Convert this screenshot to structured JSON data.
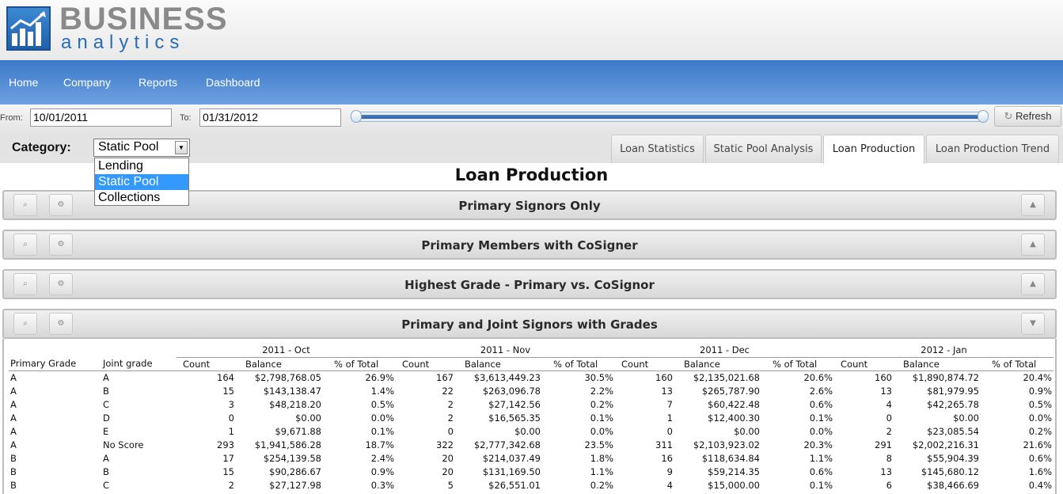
{
  "logo": {
    "line1": "BUSINESS",
    "line2": "analytics"
  },
  "nav": [
    "Home",
    "Company",
    "Reports",
    "Dashboard"
  ],
  "dates": {
    "from_label": "From:",
    "from_value": "10/01/2011",
    "to_label": "To:",
    "to_value": "01/31/2012"
  },
  "refresh": {
    "icon": "refresh-icon",
    "label": "Refresh"
  },
  "category": {
    "label": "Category:",
    "selected": "Static Pool",
    "options": [
      "Lending",
      "Static Pool",
      "Collections"
    ]
  },
  "tabs": [
    {
      "label": "Loan Statistics",
      "active": false
    },
    {
      "label": "Static Pool Analysis",
      "active": false
    },
    {
      "label": "Loan Production",
      "active": true
    },
    {
      "label": "Loan Production Trend",
      "active": false
    }
  ],
  "page_title": "Loan Production",
  "panels": [
    {
      "title": "Primary Signors Only",
      "state": "collapsed"
    },
    {
      "title": "Primary Members with CoSigner",
      "state": "collapsed"
    },
    {
      "title": "Highest Grade - Primary vs. CoSignor",
      "state": "collapsed"
    },
    {
      "title": "Primary and Joint Signors with Grades",
      "state": "expanded"
    }
  ],
  "panel_buttons": {
    "search_icon": "magnifier-icon",
    "settings_icon": "gear-icon"
  },
  "table": {
    "periods": [
      "2011 - Oct",
      "2011 - Nov",
      "2011 - Dec",
      "2012 - Jan"
    ],
    "row_headers": [
      "Primary Grade",
      "Joint grade"
    ],
    "metrics": [
      "Count",
      "Balance",
      "% of Total"
    ],
    "rows": [
      [
        "A",
        "A",
        "164",
        "$2,798,768.05",
        "26.9%",
        "167",
        "$3,613,449.23",
        "30.5%",
        "160",
        "$2,135,021.68",
        "20.6%",
        "160",
        "$1,890,874.72",
        "20.4%"
      ],
      [
        "A",
        "B",
        "15",
        "$143,138.47",
        "1.4%",
        "22",
        "$263,096.78",
        "2.2%",
        "13",
        "$265,787.90",
        "2.6%",
        "13",
        "$81,979.95",
        "0.9%"
      ],
      [
        "A",
        "C",
        "3",
        "$48,218.20",
        "0.5%",
        "2",
        "$27,142.56",
        "0.2%",
        "7",
        "$60,422.48",
        "0.6%",
        "4",
        "$42,265.78",
        "0.5%"
      ],
      [
        "A",
        "D",
        "0",
        "$0.00",
        "0.0%",
        "2",
        "$16,565.35",
        "0.1%",
        "1",
        "$12,400.30",
        "0.1%",
        "0",
        "$0.00",
        "0.0%"
      ],
      [
        "A",
        "E",
        "1",
        "$9,671.88",
        "0.1%",
        "0",
        "$0.00",
        "0.0%",
        "0",
        "$0.00",
        "0.0%",
        "2",
        "$23,085.54",
        "0.2%"
      ],
      [
        "A",
        "No Score",
        "293",
        "$1,941,586.28",
        "18.7%",
        "322",
        "$2,777,342.68",
        "23.5%",
        "311",
        "$2,103,923.02",
        "20.3%",
        "291",
        "$2,002,216.31",
        "21.6%"
      ],
      [
        "B",
        "A",
        "17",
        "$254,139.58",
        "2.4%",
        "20",
        "$214,037.49",
        "1.8%",
        "16",
        "$118,634.84",
        "1.1%",
        "8",
        "$55,904.39",
        "0.6%"
      ],
      [
        "B",
        "B",
        "15",
        "$90,286.67",
        "0.9%",
        "20",
        "$131,169.50",
        "1.1%",
        "9",
        "$59,214.35",
        "0.6%",
        "13",
        "$145,680.12",
        "1.6%"
      ],
      [
        "B",
        "C",
        "2",
        "$27,127.98",
        "0.3%",
        "5",
        "$26,551.01",
        "0.2%",
        "4",
        "$15,000.00",
        "0.1%",
        "6",
        "$38,466.69",
        "0.4%"
      ]
    ]
  }
}
